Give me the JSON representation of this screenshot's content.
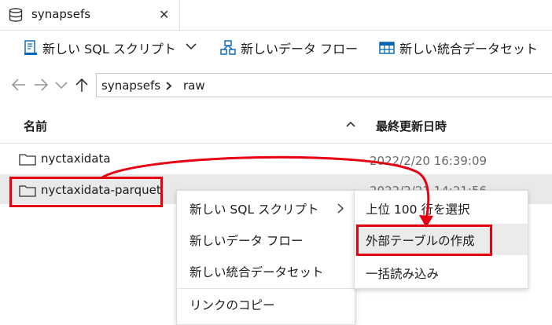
{
  "tab": {
    "title": "synapsefs",
    "close_glyph": "✕"
  },
  "toolbar": {
    "new_sql_script": "新しい SQL スクリプト",
    "new_data_flow": "新しいデータ フロー",
    "new_integration_dataset": "新しい統合データセット"
  },
  "breadcrumb": {
    "root": "synapsefs",
    "folder": "raw"
  },
  "table": {
    "col_name": "名前",
    "col_modified": "最終更新日時",
    "rows": [
      {
        "name": "nyctaxidata",
        "modified": "2022/2/20 16:39:09"
      },
      {
        "name": "nyctaxidata-parquet",
        "modified": "2022/2/21 14:21:56"
      }
    ]
  },
  "context_menu": {
    "items": [
      "新しい SQL スクリプト",
      "新しいデータ フロー",
      "新しい統合データセット",
      "リンクのコピー"
    ]
  },
  "submenu": {
    "items": [
      "上位 100 行を選択",
      "外部テーブルの作成",
      "一括読み込み"
    ]
  },
  "colors": {
    "highlight": "#e60012",
    "accent": "#0078d4"
  }
}
